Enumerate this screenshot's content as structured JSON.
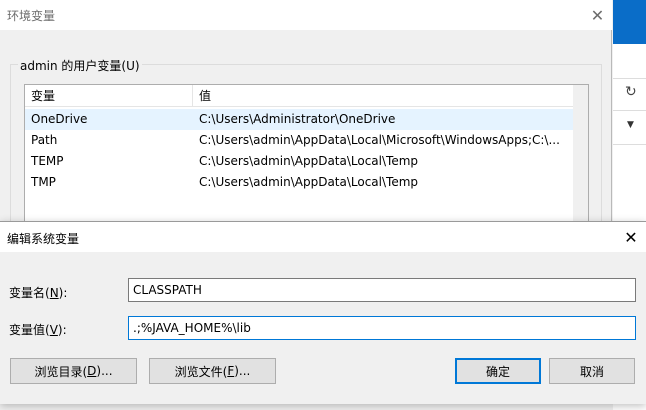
{
  "env_window": {
    "title": "环境变量",
    "close_glyph": "✕",
    "user_group_label": "admin 的用户变量(U)",
    "columns": [
      "变量",
      "值"
    ],
    "rows": [
      {
        "name": "OneDrive",
        "value": "C:\\Users\\Administrator\\OneDrive"
      },
      {
        "name": "Path",
        "value": "C:\\Users\\admin\\AppData\\Local\\Microsoft\\WindowsApps;C:\\..."
      },
      {
        "name": "TEMP",
        "value": "C:\\Users\\admin\\AppData\\Local\\Temp"
      },
      {
        "name": "TMP",
        "value": "C:\\Users\\admin\\AppData\\Local\\Temp"
      }
    ]
  },
  "side_app": {
    "accent_color": "#0a6dc8",
    "icons": [
      "refresh-icon",
      "chevron-down-icon"
    ]
  },
  "dialog": {
    "title": "编辑系统变量",
    "close_glyph": "✕",
    "name_label_pre": "变量名(",
    "name_label_key": "N",
    "name_label_post": "):",
    "name_value": "CLASSPATH",
    "value_label_pre": "变量值(",
    "value_label_key": "V",
    "value_label_post": "):",
    "value_value": ".;%JAVA_HOME%\\lib",
    "browse_dir_pre": "浏览目录(",
    "browse_dir_key": "D",
    "browse_dir_post": ")...",
    "browse_file_pre": "浏览文件(",
    "browse_file_key": "F",
    "browse_file_post": ")...",
    "ok_label": "确定",
    "cancel_label": "取消"
  }
}
